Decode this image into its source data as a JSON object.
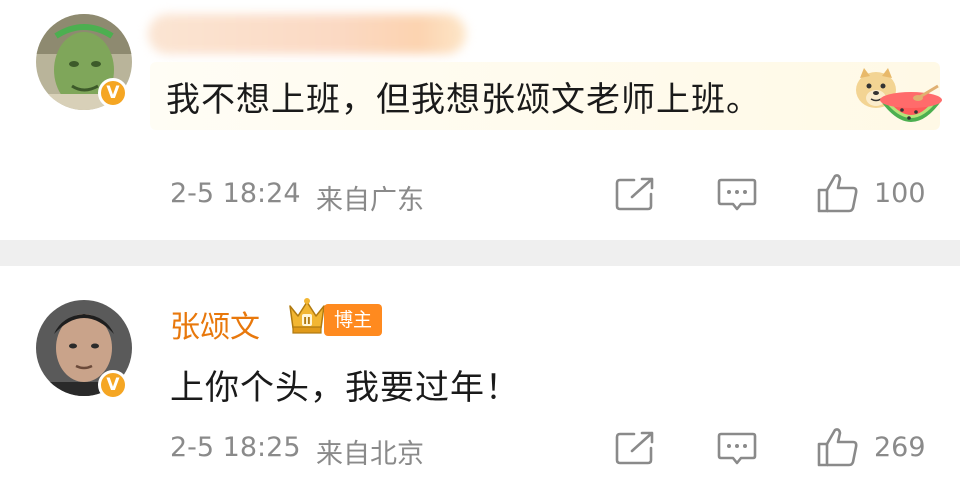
{
  "comments": [
    {
      "text": "我不想上班，但我想张颂文老师上班。",
      "verified_mark": "V",
      "time": "2-5 18:24",
      "location": "来自广东",
      "likes": "100",
      "emojis": [
        "doge-emoji",
        "watermelon-emoji"
      ]
    },
    {
      "username": "张颂文",
      "badge": "博主",
      "crown_level": "II",
      "text": "上你个头，我要过年！",
      "verified_mark": "V",
      "time": "2-5 18:25",
      "location": "来自北京",
      "likes": "269"
    }
  ],
  "colors": {
    "username": "#e8780c",
    "badge": "#ff8a1f",
    "verify": "#f5a623",
    "meta": "#8a8a8a",
    "divider": "#efefef"
  }
}
